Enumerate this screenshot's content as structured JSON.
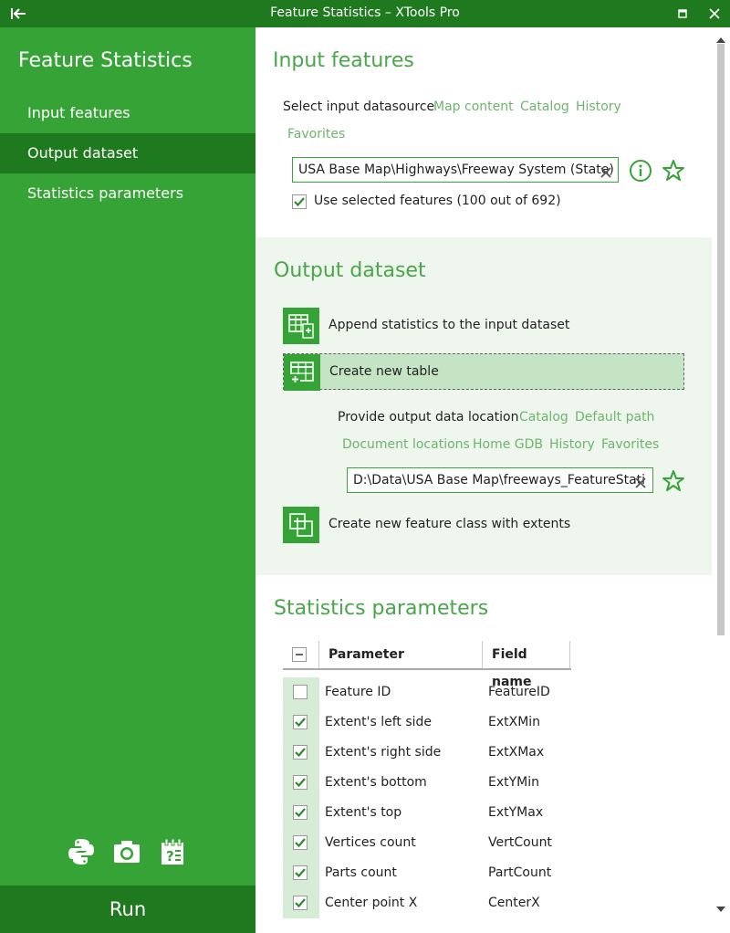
{
  "window": {
    "title": "Feature Statistics – XTools Pro"
  },
  "sidebar": {
    "heading": "Feature Statistics",
    "items": [
      {
        "label": "Input features"
      },
      {
        "label": "Output dataset"
      },
      {
        "label": "Statistics parameters"
      }
    ],
    "run_label": "Run"
  },
  "input": {
    "title": "Input features",
    "datasource_label": "Select input datasource",
    "links": [
      "Map content",
      "Catalog",
      "History",
      "Favorites"
    ],
    "path_value": "USA Base Map\\Highways\\Freeway System (State)",
    "use_selected_label": "Use selected features (100 out of 692)",
    "use_selected_checked": true
  },
  "output": {
    "title": "Output dataset",
    "options": [
      {
        "label": "Append statistics to the input dataset"
      },
      {
        "label": "Create new table"
      },
      {
        "label": "Create new feature class with extents"
      }
    ],
    "selected_option": 1,
    "location_label": "Provide output data location",
    "links_row1": [
      "Catalog",
      "Default path"
    ],
    "links_row2": [
      "Document locations",
      "Home GDB",
      "History",
      "Favorites"
    ],
    "path_value": "D:\\Data\\USA Base Map\\freeways_FeatureStati"
  },
  "stats": {
    "title": "Statistics parameters",
    "col_parameter": "Parameter",
    "col_field": "Field name",
    "rows": [
      {
        "parameter": "Feature ID",
        "field": "FeatureID",
        "checked": false
      },
      {
        "parameter": "Extent's left side",
        "field": "ExtXMin",
        "checked": true
      },
      {
        "parameter": "Extent's right side",
        "field": "ExtXMax",
        "checked": true
      },
      {
        "parameter": "Extent's bottom",
        "field": "ExtYMin",
        "checked": true
      },
      {
        "parameter": "Extent's top",
        "field": "ExtYMax",
        "checked": true
      },
      {
        "parameter": "Vertices count",
        "field": "VertCount",
        "checked": true
      },
      {
        "parameter": "Parts count",
        "field": "PartCount",
        "checked": true
      },
      {
        "parameter": "Center point X",
        "field": "CenterX",
        "checked": true
      }
    ]
  },
  "colors": {
    "brand_dark": "#1f7a1f",
    "brand": "#36a336",
    "accent_text": "#4aa64a",
    "link": "#6db56d",
    "selected_bg": "#c4e4c4"
  }
}
